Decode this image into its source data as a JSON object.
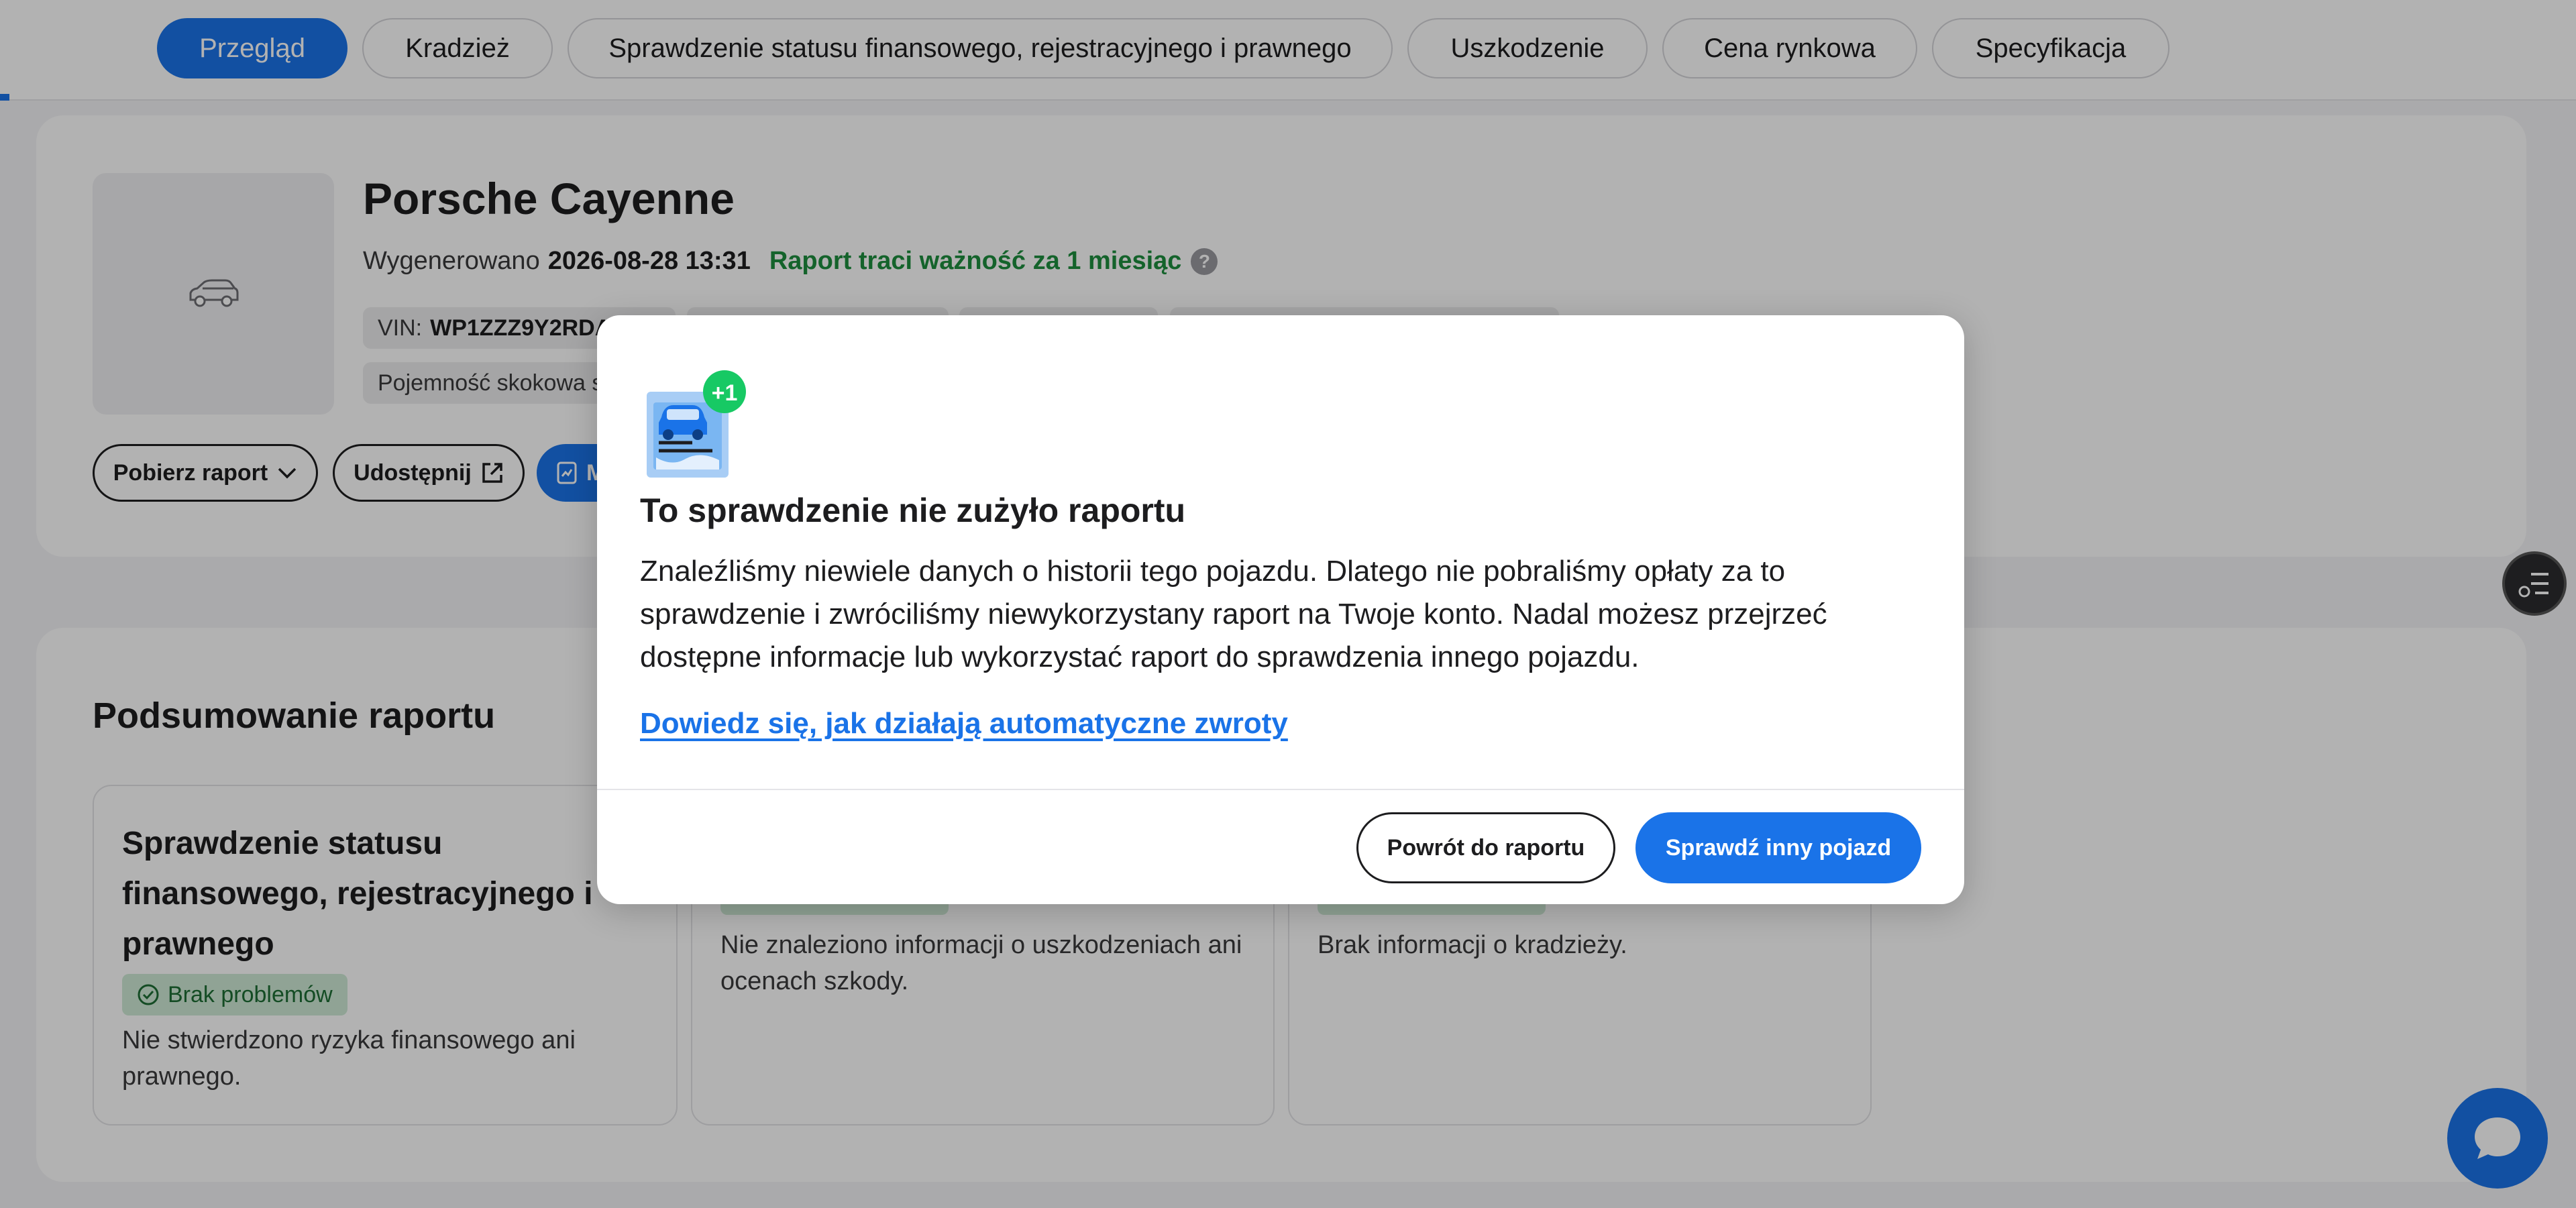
{
  "tabs": [
    {
      "label": "Przegląd",
      "active": true
    },
    {
      "label": "Kradzież",
      "active": false
    },
    {
      "label": "Sprawdzenie statusu finansowego, rejestracyjnego i prawnego",
      "active": false
    },
    {
      "label": "Uszkodzenie",
      "active": false
    },
    {
      "label": "Cena rynkowa",
      "active": false
    },
    {
      "label": "Specyfikacja",
      "active": false
    }
  ],
  "vehicle": {
    "title": "Porsche Cayenne",
    "generated_label": "Wygenerowano",
    "generated_date": "2026-08-28 13:31",
    "expiry_text": "Raport traci ważność za 1 miesiąc",
    "help_icon": "?",
    "vin_label": "VIN:",
    "vin_value": "WP1ZZZ9Y2RDA",
    "engine_label": "Pojemność skokowa s"
  },
  "actions": {
    "download_label": "Pobierz raport",
    "share_label": "Udostępnij",
    "third_label": "M"
  },
  "summary": {
    "title": "Podsumowanie raportu",
    "boxes": [
      {
        "heading": "Sprawdzenie statusu finansowego, rejestracyjnego i prawnego",
        "badge": "Brak problemów",
        "desc": "Nie stwierdzono ryzyka finansowego ani prawnego."
      },
      {
        "heading": "",
        "badge": "",
        "desc": "Nie znaleziono informacji o uszkodzeniach ani ocenach szkody."
      },
      {
        "heading": "",
        "badge": "",
        "desc": "Brak informacji o kradzieży."
      }
    ]
  },
  "modal": {
    "badge": "+1",
    "title": "To sprawdzenie nie zużyło raportu",
    "body": "Znaleźliśmy niewiele danych o historii tego pojazdu. Dlatego nie pobraliśmy opłaty za to sprawdzenie i zwróciliśmy niewykorzystany raport na Twoje konto. Nadal możesz przejrzeć dostępne informacje lub wykorzystać raport do sprawdzenia innego pojazdu.",
    "link": "Dowiedz się, jak działają automatyczne zwroty",
    "back_button": "Powrót do raportu",
    "other_button": "Sprawdź inny pojazd"
  },
  "colors": {
    "accent": "#1a73e8",
    "success": "#1e8e3e",
    "badge_bg": "#ceead6",
    "plus_badge": "#17c964"
  },
  "icons": {
    "car_placeholder": "car-outline-icon",
    "chevron": "chevron-down-icon",
    "share": "external-link-icon",
    "report": "report-icon",
    "check": "check-circle-icon",
    "side": "checklist-icon",
    "chat": "chat-bubble-icon"
  }
}
